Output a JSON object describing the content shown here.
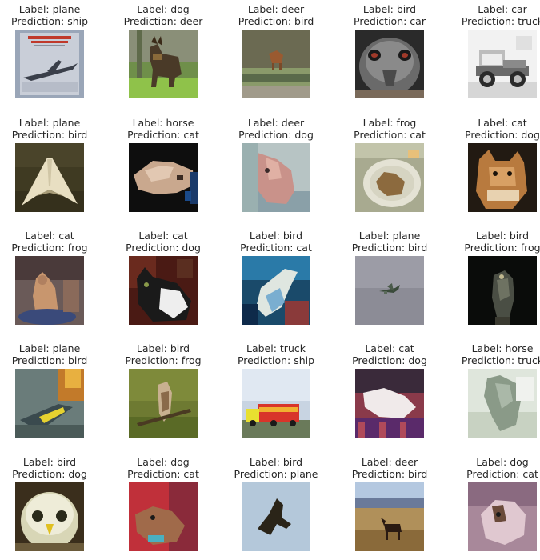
{
  "figure": {
    "label_prefix": "Label: ",
    "prediction_prefix": "Prediction: ",
    "items": [
      {
        "label": "plane",
        "prediction": "ship",
        "scene": "plane-poster"
      },
      {
        "label": "dog",
        "prediction": "deer",
        "scene": "dog-grass"
      },
      {
        "label": "deer",
        "prediction": "bird",
        "scene": "deer-field"
      },
      {
        "label": "bird",
        "prediction": "car",
        "scene": "ostrich-face"
      },
      {
        "label": "car",
        "prediction": "truck",
        "scene": "vintage-car"
      },
      {
        "label": "plane",
        "prediction": "bird",
        "scene": "stealth-plane"
      },
      {
        "label": "horse",
        "prediction": "cat",
        "scene": "horse-dark"
      },
      {
        "label": "deer",
        "prediction": "dog",
        "scene": "deer-closeup"
      },
      {
        "label": "frog",
        "prediction": "cat",
        "scene": "frog-plate"
      },
      {
        "label": "cat",
        "prediction": "dog",
        "scene": "cat-brown"
      },
      {
        "label": "cat",
        "prediction": "frog",
        "scene": "cat-sitting"
      },
      {
        "label": "cat",
        "prediction": "dog",
        "scene": "cat-bw"
      },
      {
        "label": "bird",
        "prediction": "cat",
        "scene": "bird-blue"
      },
      {
        "label": "plane",
        "prediction": "bird",
        "scene": "plane-sky"
      },
      {
        "label": "bird",
        "prediction": "frog",
        "scene": "bird-dark"
      },
      {
        "label": "plane",
        "prediction": "bird",
        "scene": "plane-fire"
      },
      {
        "label": "bird",
        "prediction": "frog",
        "scene": "bird-branch"
      },
      {
        "label": "truck",
        "prediction": "ship",
        "scene": "truck-red"
      },
      {
        "label": "cat",
        "prediction": "dog",
        "scene": "cat-blanket"
      },
      {
        "label": "horse",
        "prediction": "truck",
        "scene": "horse-blur"
      },
      {
        "label": "bird",
        "prediction": "dog",
        "scene": "owl-face"
      },
      {
        "label": "dog",
        "prediction": "cat",
        "scene": "dog-red"
      },
      {
        "label": "bird",
        "prediction": "plane",
        "scene": "bird-flying"
      },
      {
        "label": "deer",
        "prediction": "bird",
        "scene": "deer-savanna"
      },
      {
        "label": "dog",
        "prediction": "cat",
        "scene": "dog-pink"
      }
    ]
  }
}
